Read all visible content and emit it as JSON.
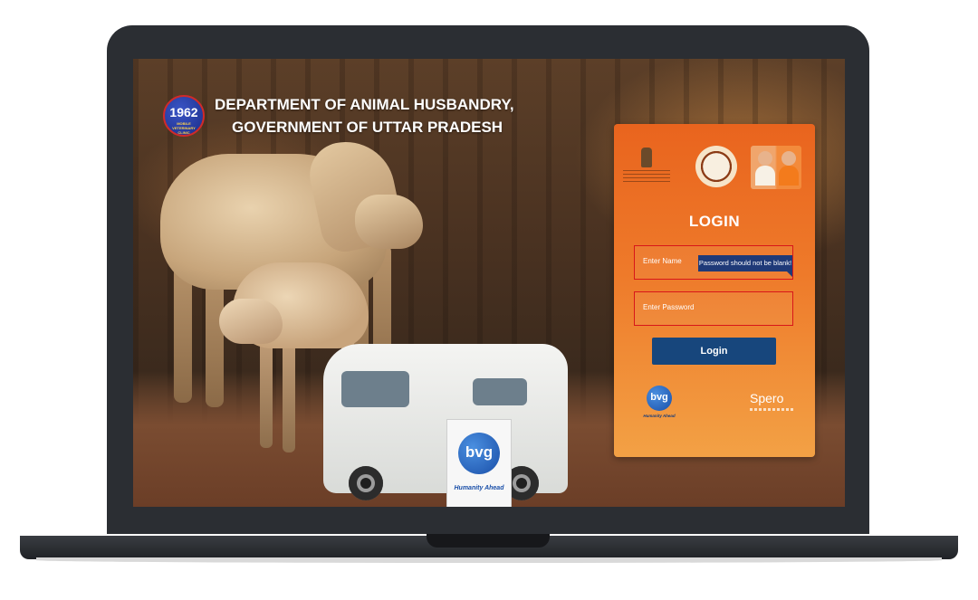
{
  "header": {
    "logo_number": "1962",
    "logo_subtext": "MOBILE VETERINARY CLINIC",
    "title_line1": "DEPARTMENT OF ANIMAL HUSBANDRY,",
    "title_line2": "GOVERNMENT OF UTTAR PRADESH"
  },
  "hero": {
    "sign_logo": "bvg",
    "sign_tagline": "Humanity Ahead"
  },
  "login": {
    "title": "LOGIN",
    "username_placeholder": "Enter Name",
    "password_placeholder": "Enter Password",
    "error_tooltip": "Password should not be blank!",
    "button_label": "Login"
  },
  "footer_logos": {
    "bvg": "bvg",
    "bvg_tagline": "Humanity Ahead",
    "spero": "Spero"
  },
  "colors": {
    "card_top": "#e9641e",
    "card_bottom": "#f3a145",
    "button": "#17467c",
    "error_border": "#d8161a",
    "tooltip": "#1f3a78"
  }
}
